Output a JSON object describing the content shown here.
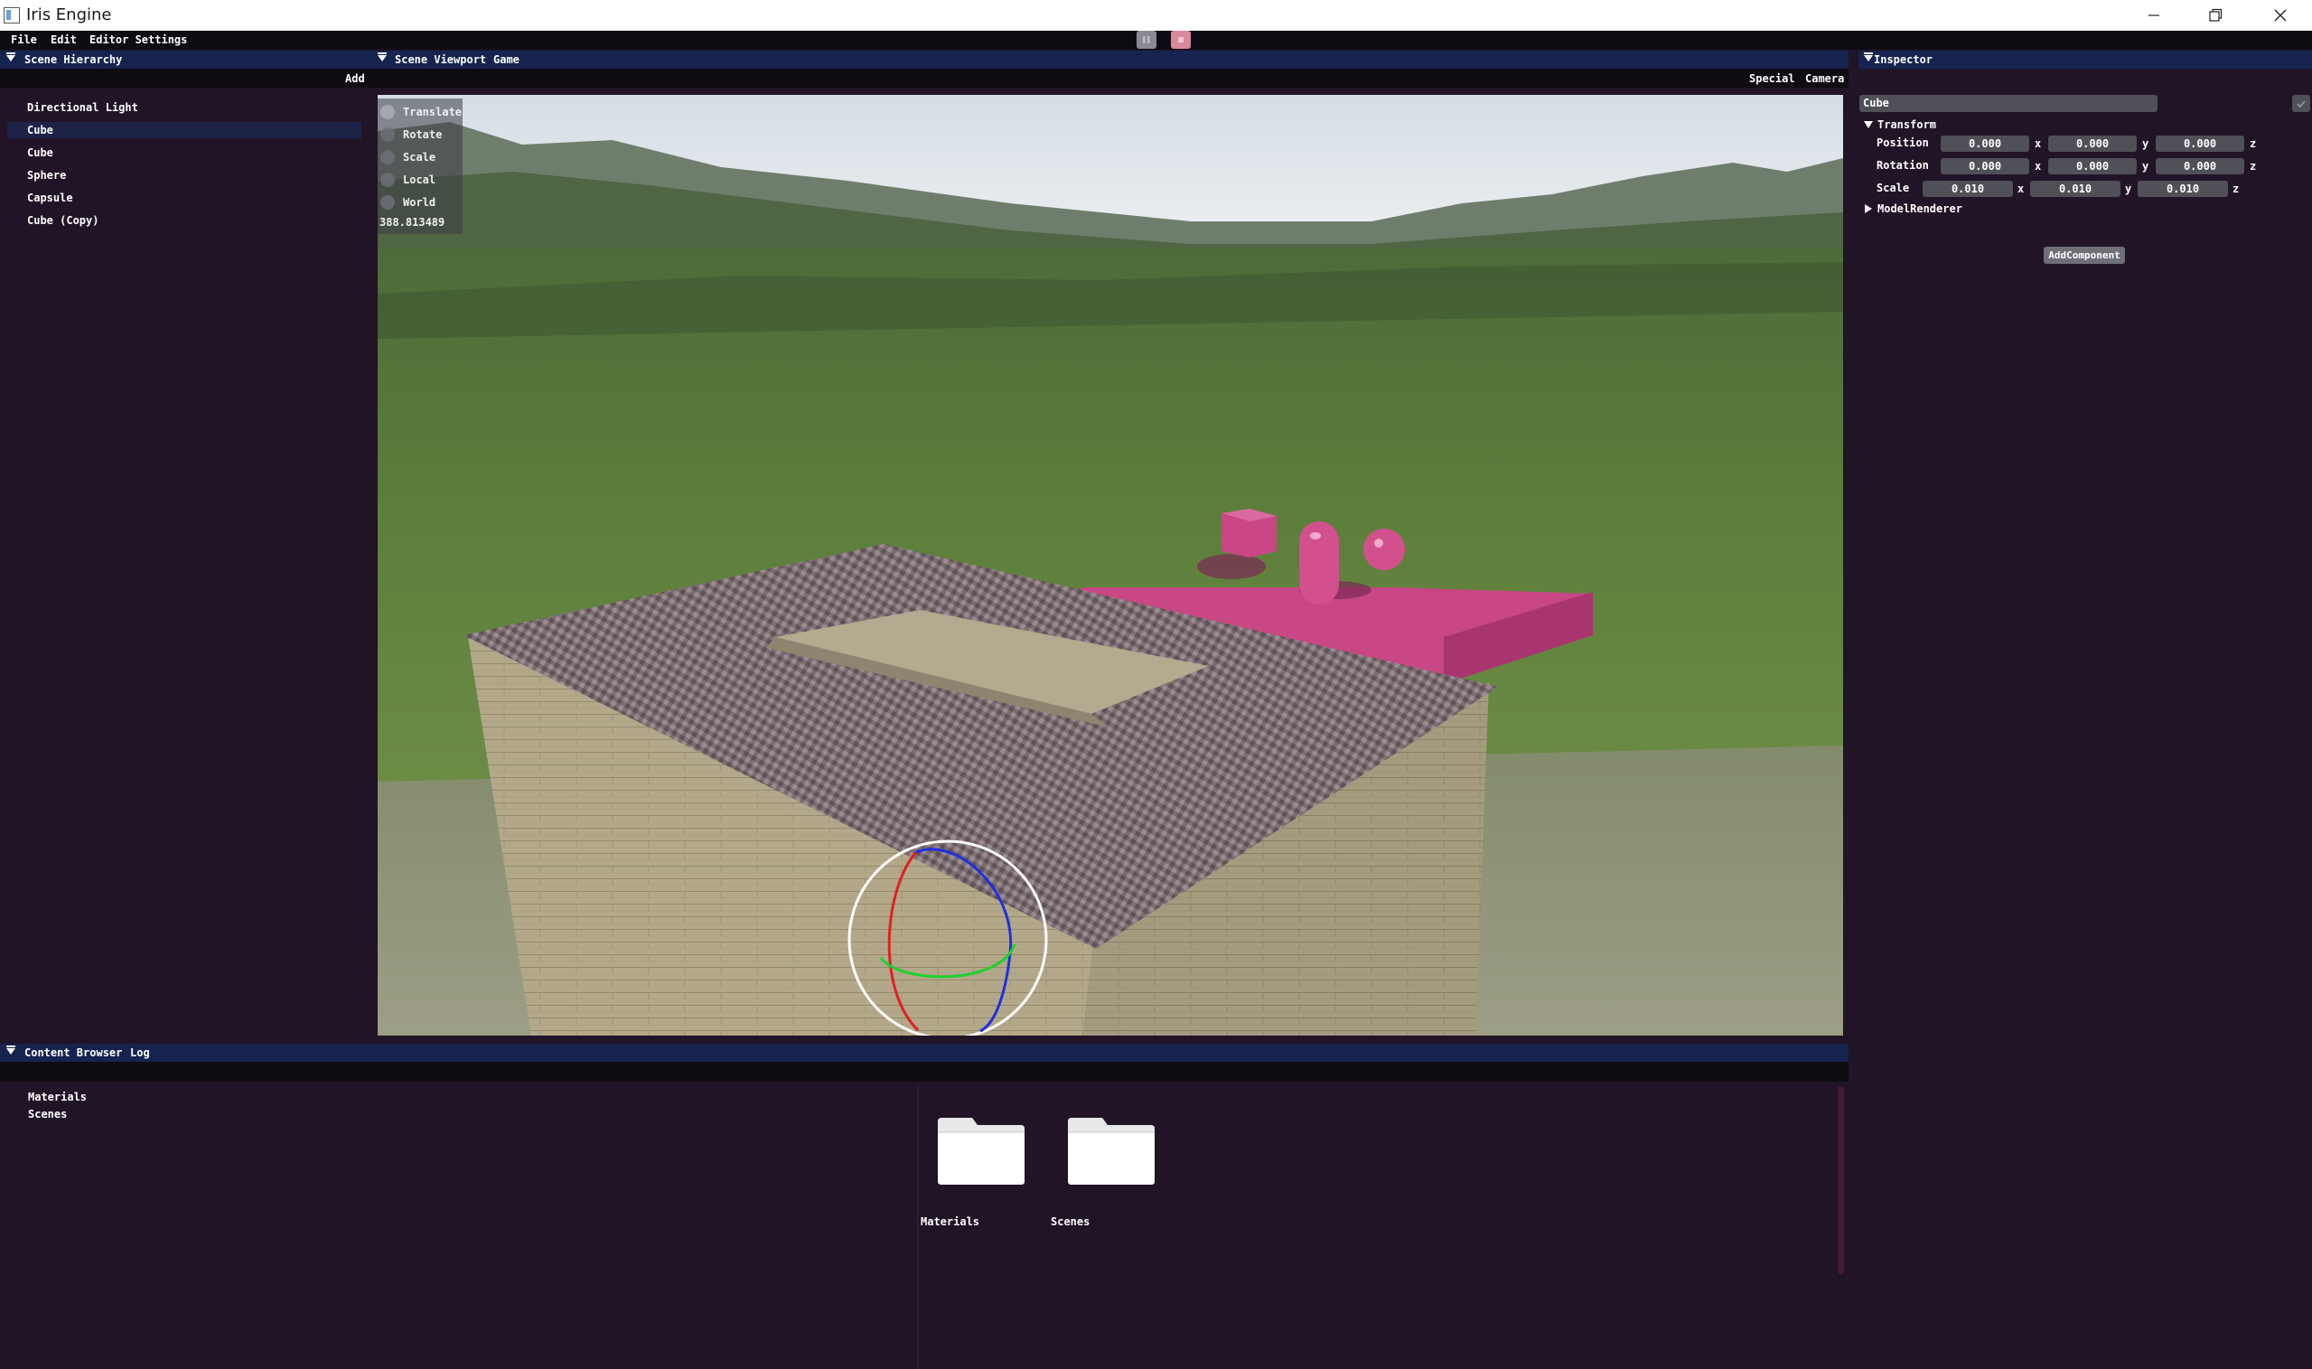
{
  "window": {
    "title": "Iris Engine",
    "minimize_icon": "minimize-icon",
    "restore_icon": "restore-icon",
    "close_icon": "close-icon"
  },
  "menu": {
    "items": [
      "File",
      "Edit",
      "Editor Settings"
    ],
    "play_icon": "play-icon",
    "stop_icon": "stop-icon",
    "play_color": "#8a8a94",
    "stop_color": "#d98a9a"
  },
  "hierarchy": {
    "title": "Scene Hierarchy",
    "add_label": "Add",
    "selected_index": 1,
    "items": [
      "Directional Light",
      "Cube",
      "Cube",
      "Sphere",
      "Capsule",
      "Cube (Copy)"
    ]
  },
  "viewport": {
    "tabs": [
      "Scene Viewport",
      "Game"
    ],
    "toolbar": [
      "Special",
      "Camera"
    ],
    "gizmo_options": [
      "Translate",
      "Rotate",
      "Scale",
      "Local",
      "World"
    ],
    "active_option": "Translate",
    "gizmo_value": "388.813489",
    "scene_description_colors": {
      "sky": "#dfe6ec",
      "grass": "#5e7e3a",
      "platform": "#c84784"
    }
  },
  "inspector": {
    "title": "Inspector",
    "object_name": "Cube",
    "transform": {
      "label": "Transform",
      "position_label": "Position",
      "rotation_label": "Rotation",
      "scale_label": "Scale",
      "position": [
        "0.000",
        "0.000",
        "0.000"
      ],
      "rotation": [
        "0.000",
        "0.000",
        "0.000"
      ],
      "scale": [
        "0.010",
        "0.010",
        "0.010"
      ],
      "axes": [
        "x",
        "y",
        "z"
      ]
    },
    "model_renderer_label": "ModelRenderer",
    "add_component_label": "AddComponent"
  },
  "content_browser": {
    "tabs": [
      "Content Browser",
      "Log"
    ],
    "tree": [
      "Materials",
      "Scenes"
    ],
    "folders": [
      "Materials",
      "Scenes"
    ],
    "folder_icon": "folder-icon"
  },
  "colors": {
    "panel_bg": "#211426",
    "header_bg": "#16234f",
    "field_bg": "#505058",
    "selection_bg": "#1d2347"
  }
}
